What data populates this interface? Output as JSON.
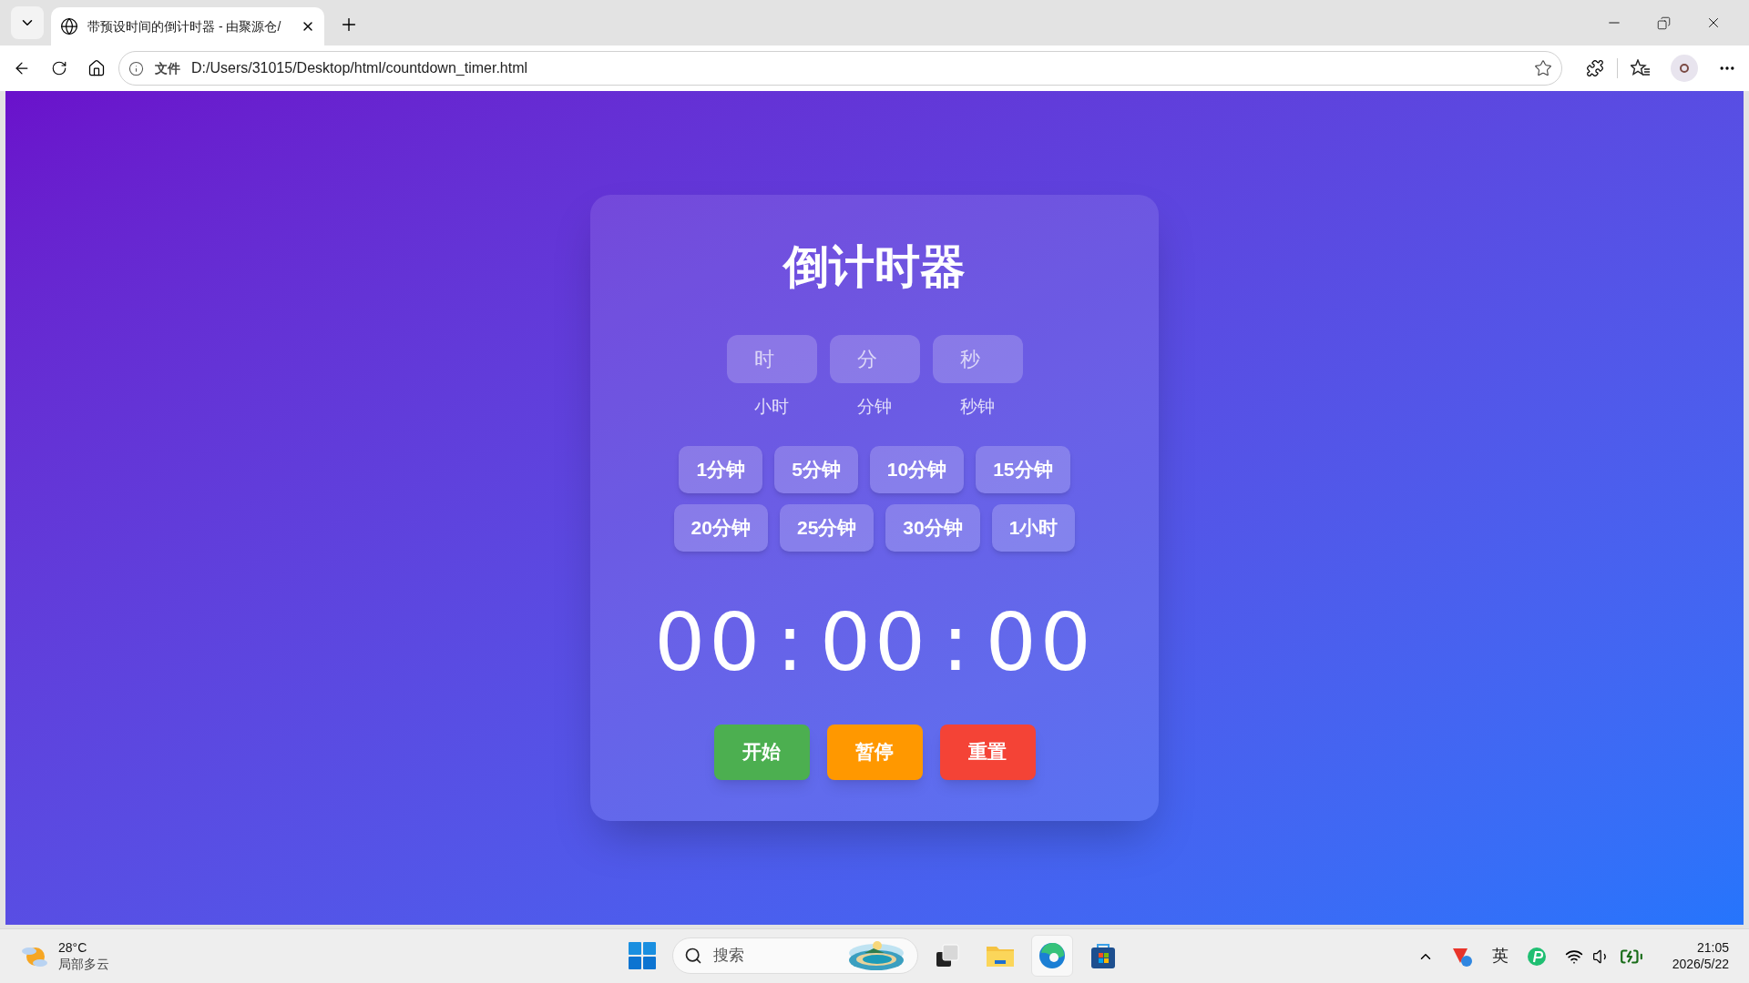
{
  "browser": {
    "tab_title": "带预设时间的倒计时器 - 由聚源仓/",
    "address_label": "文件",
    "url": "D:/Users/31015/Desktop/html/countdown_timer.html"
  },
  "page": {
    "title": "倒计时器",
    "inputs": [
      {
        "placeholder": "时",
        "label": "小时"
      },
      {
        "placeholder": "分",
        "label": "分钟"
      },
      {
        "placeholder": "秒",
        "label": "秒钟"
      }
    ],
    "presets": [
      "1分钟",
      "5分钟",
      "10分钟",
      "15分钟",
      "20分钟",
      "25分钟",
      "30分钟",
      "1小时"
    ],
    "display": [
      "00",
      "00",
      "00"
    ],
    "separator": ":",
    "controls": [
      {
        "label": "开始",
        "kind": "start"
      },
      {
        "label": "暂停",
        "kind": "pause"
      },
      {
        "label": "重置",
        "kind": "reset"
      }
    ]
  },
  "taskbar": {
    "weather": {
      "temperature": "28°C",
      "condition": "局部多云"
    },
    "search_placeholder": "搜索",
    "input_method": "英",
    "time": "21:05",
    "date": "2026/5/22"
  }
}
